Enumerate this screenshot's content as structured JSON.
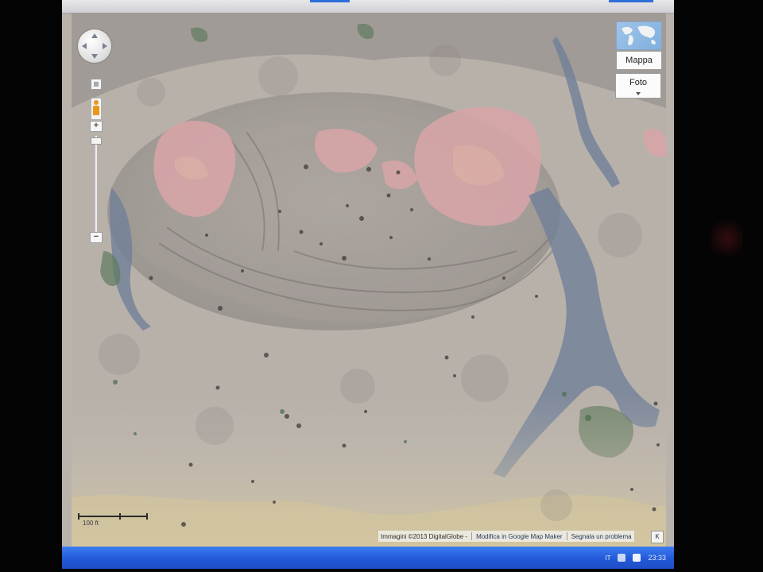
{
  "map": {
    "controls": {
      "pan": "pan-control",
      "reset": "reset-button",
      "street_view": "pegman-icon",
      "zoom_in": "+",
      "zoom_out": "−",
      "zoom_level_fraction": 0.02
    },
    "map_type": {
      "map_label": "Mappa",
      "photo_label": "Foto"
    },
    "scale_label": "100 ft",
    "attribution": {
      "imagery": "Immagini ©2013 DigitalGlobe -",
      "edit_link": "Modifica in Google Map Maker",
      "report_link": "Segnala un problema",
      "close": "K"
    }
  },
  "taskbar": {
    "language": "IT",
    "time": "23:33"
  },
  "colors": {
    "terrain": "#b7b0a9",
    "taskbar": "#2359d8",
    "pink_patch": "#d8a7a7",
    "vegetation": "#6f7f98"
  }
}
